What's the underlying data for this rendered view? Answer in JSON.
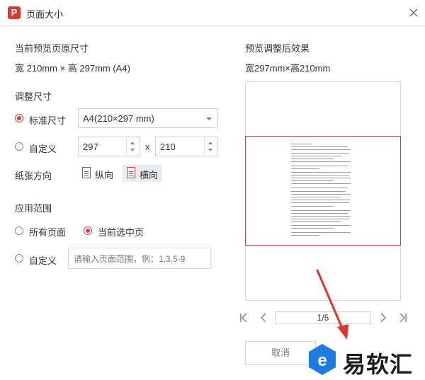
{
  "window": {
    "title": "页面大小",
    "logo_letter": "P"
  },
  "left": {
    "current_label": "当前预览页原尺寸",
    "current_size": "宽 210mm × 高 297mm (A4)",
    "adjust_label": "调整尺寸",
    "standard_label": "标准尺寸",
    "standard_value": "A4(210×297 mm)",
    "custom_label": "自定义",
    "width_value": "297",
    "times": "x",
    "height_value": "210",
    "orientation_label": "纸张方向",
    "portrait_label": "纵向",
    "landscape_label": "横向",
    "range_label": "应用范围",
    "all_pages_label": "所有页面",
    "current_page_label": "当前选中页",
    "range_custom_label": "自定义",
    "range_placeholder": "请输入页面范围，例：1,3,5-9"
  },
  "right": {
    "preview_label": "预览调整后效果",
    "preview_size": "宽297mm×高210mm",
    "page_indicator": "1/5"
  },
  "footer": {
    "cancel_label": "取消"
  },
  "watermark": {
    "text": "易软汇",
    "letter": "e"
  },
  "colors": {
    "accent": "#c9453f",
    "logo_red": "#d93a2f",
    "arrow_red": "#e0342b",
    "watermark_blue": "#1e7be0"
  }
}
